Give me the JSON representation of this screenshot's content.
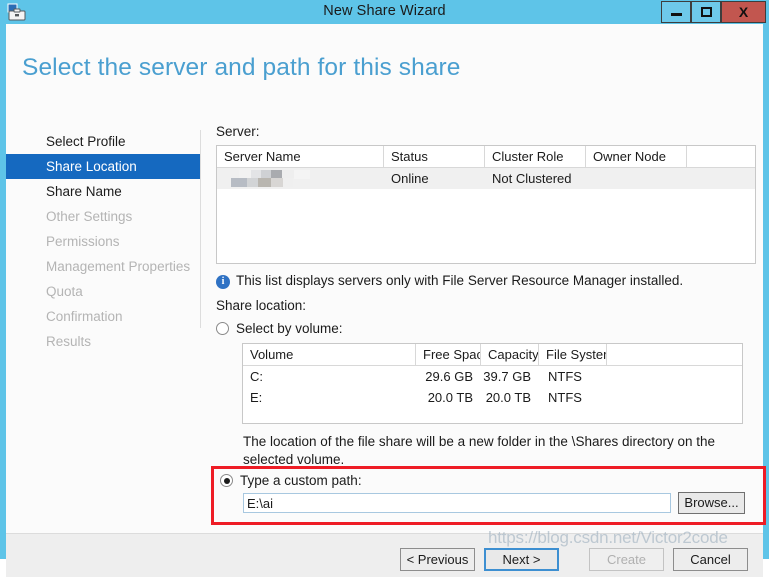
{
  "window": {
    "title": "New Share Wizard",
    "icon": "server-manager-icon",
    "minimize_label": "Minimize",
    "maximize_label": "Maximize",
    "close_label": "X",
    "titlebar_color": "#5ec4e8",
    "close_color": "#c2564f"
  },
  "header": {
    "page_title": "Select the server and path for this share",
    "title_color": "#4a9fd0"
  },
  "sidebar": {
    "active_color": "#1569c0",
    "items": [
      {
        "label": "Select Profile",
        "state": "completed"
      },
      {
        "label": "Share Location",
        "state": "active"
      },
      {
        "label": "Share Name",
        "state": "completed"
      },
      {
        "label": "Other Settings",
        "state": "disabled"
      },
      {
        "label": "Permissions",
        "state": "disabled"
      },
      {
        "label": "Management Properties",
        "state": "disabled"
      },
      {
        "label": "Quota",
        "state": "disabled"
      },
      {
        "label": "Confirmation",
        "state": "disabled"
      },
      {
        "label": "Results",
        "state": "disabled"
      }
    ]
  },
  "main": {
    "server_label": "Server:",
    "server_table": {
      "columns": [
        "Server Name",
        "Status",
        "Cluster Role",
        "Owner Node",
        ""
      ],
      "rows": [
        {
          "server_name": "",
          "server_name_redacted": true,
          "status": "Online",
          "cluster_role": "Not Clustered",
          "owner_node": "",
          "selected": true
        }
      ]
    },
    "info_message": "This list displays servers only with File Server Resource Manager installed.",
    "info_icon": "info-icon",
    "share_location_label": "Share location:",
    "select_by_volume": {
      "label": "Select by volume:",
      "checked": false
    },
    "volume_table": {
      "columns": [
        "Volume",
        "Free Space",
        "Capacity",
        "File System",
        ""
      ],
      "rows": [
        {
          "volume": "C:",
          "free_space": "29.6 GB",
          "capacity": "39.7 GB",
          "file_system": "NTFS"
        },
        {
          "volume": "E:",
          "free_space": "20.0 TB",
          "capacity": "20.0 TB",
          "file_system": "NTFS"
        }
      ]
    },
    "description": "The location of the file share will be a new folder in the \\Shares directory on the selected volume.",
    "custom_path": {
      "label": "Type a custom path:",
      "checked": true,
      "value": "E:\\ai",
      "placeholder": "",
      "browse_label": "Browse...",
      "highlight_color": "#ee1c25"
    }
  },
  "footer": {
    "previous_label": "< Previous",
    "next_label": "Next >",
    "create_label": "Create",
    "cancel_label": "Cancel"
  },
  "watermark": {
    "text": "https://blog.csdn.net/Victor2code"
  }
}
